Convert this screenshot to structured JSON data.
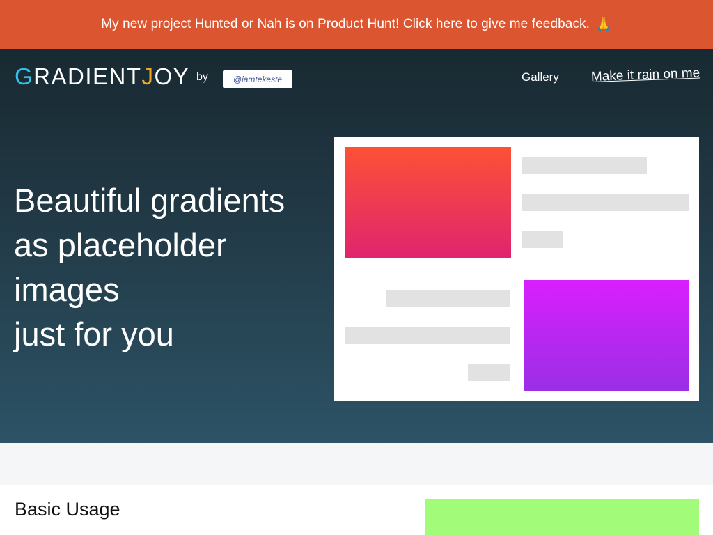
{
  "banner": {
    "text": "My new project Hunted or Nah is on Product Hunt! Click here to give me feedback.",
    "emoji": "🙏",
    "color": "#db5630"
  },
  "header": {
    "logo_first_letter": "G",
    "logo_middle": "RADIENT",
    "logo_j": "J",
    "logo_end": "OY",
    "by_label": "by",
    "handle": "@iamtekeste",
    "nav": {
      "gallery": "Gallery",
      "rain": "Make it rain on me"
    }
  },
  "hero": {
    "headline_lines": [
      "Beautiful gradients",
      "as placeholder",
      "images",
      "just for you"
    ]
  },
  "preview": {
    "gradient_top": {
      "from": "#fd5136",
      "to": "#e0246e"
    },
    "gradient_bottom": {
      "from": "#d91ffd",
      "to": "#9a2fe6"
    }
  },
  "basic_usage": {
    "title": "Basic Usage",
    "swatch_color": "#a3fc79"
  }
}
